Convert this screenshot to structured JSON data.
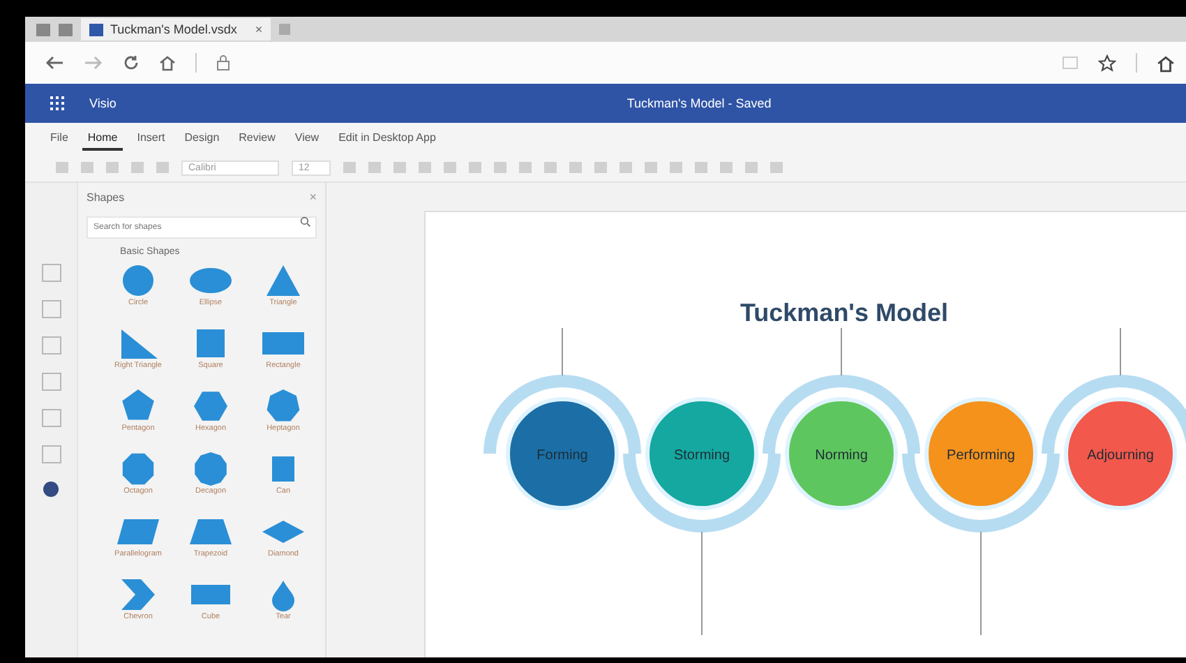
{
  "browser": {
    "tab_title": "Tuckman's Model.vsdx",
    "tab_close": "×"
  },
  "app": {
    "name": "Visio",
    "document_title": "Tuckman's Model - Saved"
  },
  "ribbon_tabs": [
    {
      "label": "File",
      "selected": false
    },
    {
      "label": "Home",
      "selected": true
    },
    {
      "label": "Insert",
      "selected": false
    },
    {
      "label": "Design",
      "selected": false
    },
    {
      "label": "Review",
      "selected": false
    },
    {
      "label": "View",
      "selected": false
    },
    {
      "label": "Edit in Desktop App",
      "selected": false
    }
  ],
  "toolbar": {
    "font": "Calibri",
    "size": "12"
  },
  "shapes_panel": {
    "title": "Shapes",
    "close": "×",
    "search": {
      "placeholder": "Search for shapes"
    },
    "section": "Basic Shapes",
    "shapes": [
      {
        "label": "Circle",
        "kind": "circle"
      },
      {
        "label": "Ellipse",
        "kind": "ellipse"
      },
      {
        "label": "Triangle",
        "kind": "triangle"
      },
      {
        "label": "Right Triangle",
        "kind": "right-triangle"
      },
      {
        "label": "Square",
        "kind": "square"
      },
      {
        "label": "Rectangle",
        "kind": "rectangle"
      },
      {
        "label": "Pentagon",
        "kind": "pentagon"
      },
      {
        "label": "Hexagon",
        "kind": "hexagon"
      },
      {
        "label": "Heptagon",
        "kind": "heptagon"
      },
      {
        "label": "Octagon",
        "kind": "octagon"
      },
      {
        "label": "Decagon",
        "kind": "decagon"
      },
      {
        "label": "Can",
        "kind": "can"
      },
      {
        "label": "Parallelogram",
        "kind": "parallelogram"
      },
      {
        "label": "Trapezoid",
        "kind": "trapezoid"
      },
      {
        "label": "Diamond",
        "kind": "diamond"
      },
      {
        "label": "Chevron",
        "kind": "chevron"
      },
      {
        "label": "Cube",
        "kind": "cube"
      },
      {
        "label": "Tear",
        "kind": "tear"
      }
    ]
  },
  "diagram": {
    "title": "Tuckman's Model",
    "stages": [
      {
        "label": "Forming",
        "color": "#1b6fa6"
      },
      {
        "label": "Storming",
        "color": "#14a8a0"
      },
      {
        "label": "Norming",
        "color": "#5ec65e"
      },
      {
        "label": "Performing",
        "color": "#f4921c"
      },
      {
        "label": "Adjourning",
        "color": "#f2584b"
      }
    ]
  }
}
